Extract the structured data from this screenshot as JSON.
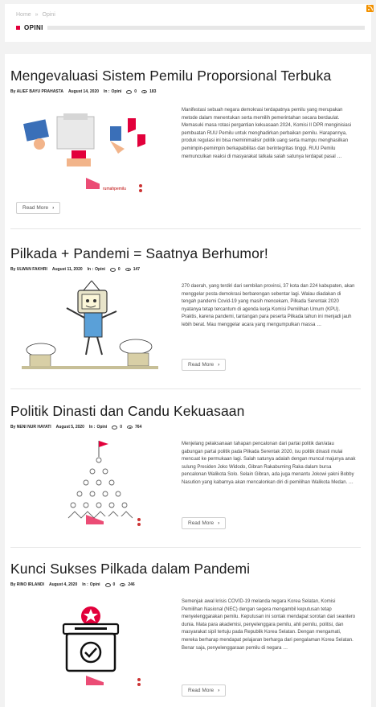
{
  "breadcrumb": {
    "home": "Home",
    "separator": "»",
    "current": "Opini"
  },
  "section": {
    "title": "OPINI"
  },
  "rss_icon": "rss-icon",
  "accent_color": "#e2003b",
  "articles": [
    {
      "title": "Mengevaluasi Sistem Pemilu Proporsional Terbuka",
      "author": "By ALIEF BAYU PRAHASTA",
      "date": "August 14, 2020",
      "category_prefix": "In :",
      "category": "Opini",
      "comments": "0",
      "views": "183",
      "excerpt": "Manifestasi sebuah negara demokrasi terdapatnya pemilu yang merupakan metode dalam menentukan serta memilih pemerintahan secara berdaulat. Memasuki masa rotasi pergantian kekuasaan 2024, Komisi II DPR menginisiasi pembuatan RUU Pemilu untuk menghadirkan perbaikan pemilu. Harapannya, produk regulasi ini bisa meminimalisir politik uang serta mampu menghasilkan pemimpin-pemimpin berkapabilitas dan berintegritas tinggi. RUU Pemilu memunculkan reaksi di masyarakat tatkala salah satunya terdapat pasal …",
      "read_more": "Read More"
    },
    {
      "title": "Pilkada + Pandemi = Saatnya Berhumor!",
      "author": "By ULWAN FAKHRI",
      "date": "August 11, 2020",
      "category_prefix": "In :",
      "category": "Opini",
      "comments": "0",
      "views": "147",
      "excerpt": "270 daerah, yang terdiri dari sembilan provinsi, 37 kota dan 224 kabupaten, akan menggelar pesta demokrasi berbarengan sebentar lagi. Walau diadakan di tengah pandemi Covid-19 yang masih mencekam, Pilkada Serentak 2020 nyatanya tetap tercantum di agenda kerja Komisi Pemilihan Umum (KPU). Praktis, karena pandemi, tantangan para peserta Pilkada tahun ini menjadi jauh lebih berat. Mau menggelar acara yang mengumpulkan massa …",
      "read_more": "Read More"
    },
    {
      "title": "Politik Dinasti dan Candu Kekuasaan",
      "author": "By NENI NUR HAYATI",
      "date": "August 5, 2020",
      "category_prefix": "In :",
      "category": "Opini",
      "comments": "0",
      "views": "764",
      "excerpt": "Menjelang pelaksanaan tahapan pencalonan dari partai politik dan/atau gabungan partai politik pada Pilkada Serentak 2020, isu politik dinasti mulai mencuat ke permukaan lagi. Salah satunya adalah dengan muncul majunya anak sulung Presiden Joko Widodo, Gibran Rakabuming Raka dalam bursa pencalonan Walikota Solo. Selain Gibran, ada juga menantu Jokowi yakni Bobby Nasution yang kabarnya akan mencalonkan diri di pemilihan Walikota Medan. …",
      "read_more": "Read More"
    },
    {
      "title": "Kunci Sukses Pilkada dalam Pandemi",
      "author": "By RINO IRLANDI",
      "date": "August 4, 2020",
      "category_prefix": "In :",
      "category": "Opini",
      "comments": "0",
      "views": "246",
      "excerpt": "Semenjak awal krisis COVID-19 melanda negara Korea Selatan, Komisi Pemilihan Nasional (NEC) dengan segera mengambil keputusan tetap menyelenggarakan pemilu. Keputusan ini sontak mendapat sorotan dari seantero dunia. Mata para akademisi, penyelenggara pemilu, ahli pemilu, politisi, dan masyarakat sipil tertuju pada Republik Korea Selatan. Dengan mengamati, mereka berharap mendapat pelajaran berharga dari pengalaman Korea Selatan. Benar saja, penyelenggaraan pemilu di negara …",
      "read_more": "Read More"
    }
  ]
}
